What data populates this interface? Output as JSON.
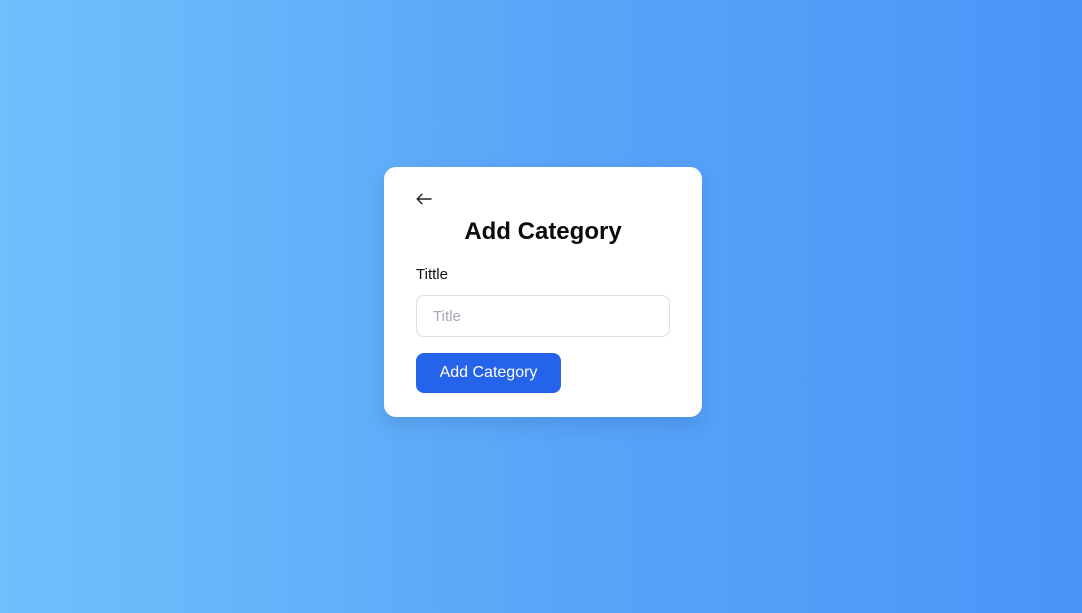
{
  "form": {
    "heading": "Add Category",
    "field_label": "Tittle",
    "title_placeholder": "Title",
    "title_value": "",
    "submit_label": "Add Category"
  },
  "icons": {
    "back": "arrow-left-icon"
  },
  "colors": {
    "background_start": "#6ec1fb",
    "background_end": "#4a94f8",
    "card": "#ffffff",
    "primary_button": "#2563eb"
  }
}
